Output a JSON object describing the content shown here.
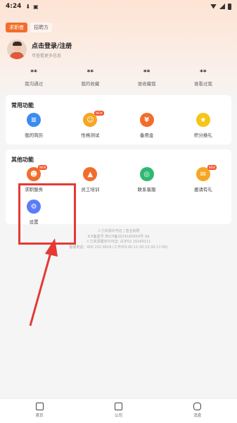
{
  "status_bar": {
    "time": "4:24"
  },
  "role_tabs": [
    "求职者",
    "招聘方"
  ],
  "profile": {
    "name": "点击登录/注册",
    "subtitle": "可查看更多信息"
  },
  "stats": [
    {
      "num": "**",
      "label": "我沟通过"
    },
    {
      "num": "**",
      "label": "我的收藏"
    },
    {
      "num": "**",
      "label": "谁收藏我"
    },
    {
      "num": "**",
      "label": "谁看过我"
    }
  ],
  "common": {
    "title": "常用功能",
    "items": [
      {
        "label": "我的简历",
        "color": "#3b8cf0",
        "icon": "resume-icon"
      },
      {
        "label": "性格测试",
        "color": "#f5a623",
        "icon": "personality-test-icon",
        "badge": "NEW"
      },
      {
        "label": "备用金",
        "color": "#f26d2b",
        "icon": "wallet-icon"
      },
      {
        "label": "积分换礼",
        "color": "#f5c518",
        "icon": "gift-points-icon"
      }
    ]
  },
  "other": {
    "title": "其他功能",
    "items": [
      {
        "label": "求职服务",
        "color": "#f26d2b",
        "icon": "service-icon",
        "badge": "NEW"
      },
      {
        "label": "员工培训",
        "color": "#f26d2b",
        "icon": "training-icon"
      },
      {
        "label": "联系客服",
        "color": "#2eb872",
        "icon": "support-icon"
      },
      {
        "label": "邀请有礼",
        "color": "#f5a623",
        "icon": "invite-icon",
        "badge": "NEW"
      },
      {
        "label": "设置",
        "color": "#5c7cfa",
        "icon": "settings-icon"
      }
    ]
  },
  "footer": [
    "人力资源许可证 | 营业执照",
    "ICP备案号:粤ICP备2024165654号-3A",
    "人力资源服务许可证: 白字02 20240111",
    "客服电话：400 152 6618 (工作日9:00-11:30,13:30-17:00)"
  ],
  "bottom_nav": [
    "首页",
    "公司",
    "消息"
  ],
  "annotation": {
    "box_color": "#e53935"
  }
}
